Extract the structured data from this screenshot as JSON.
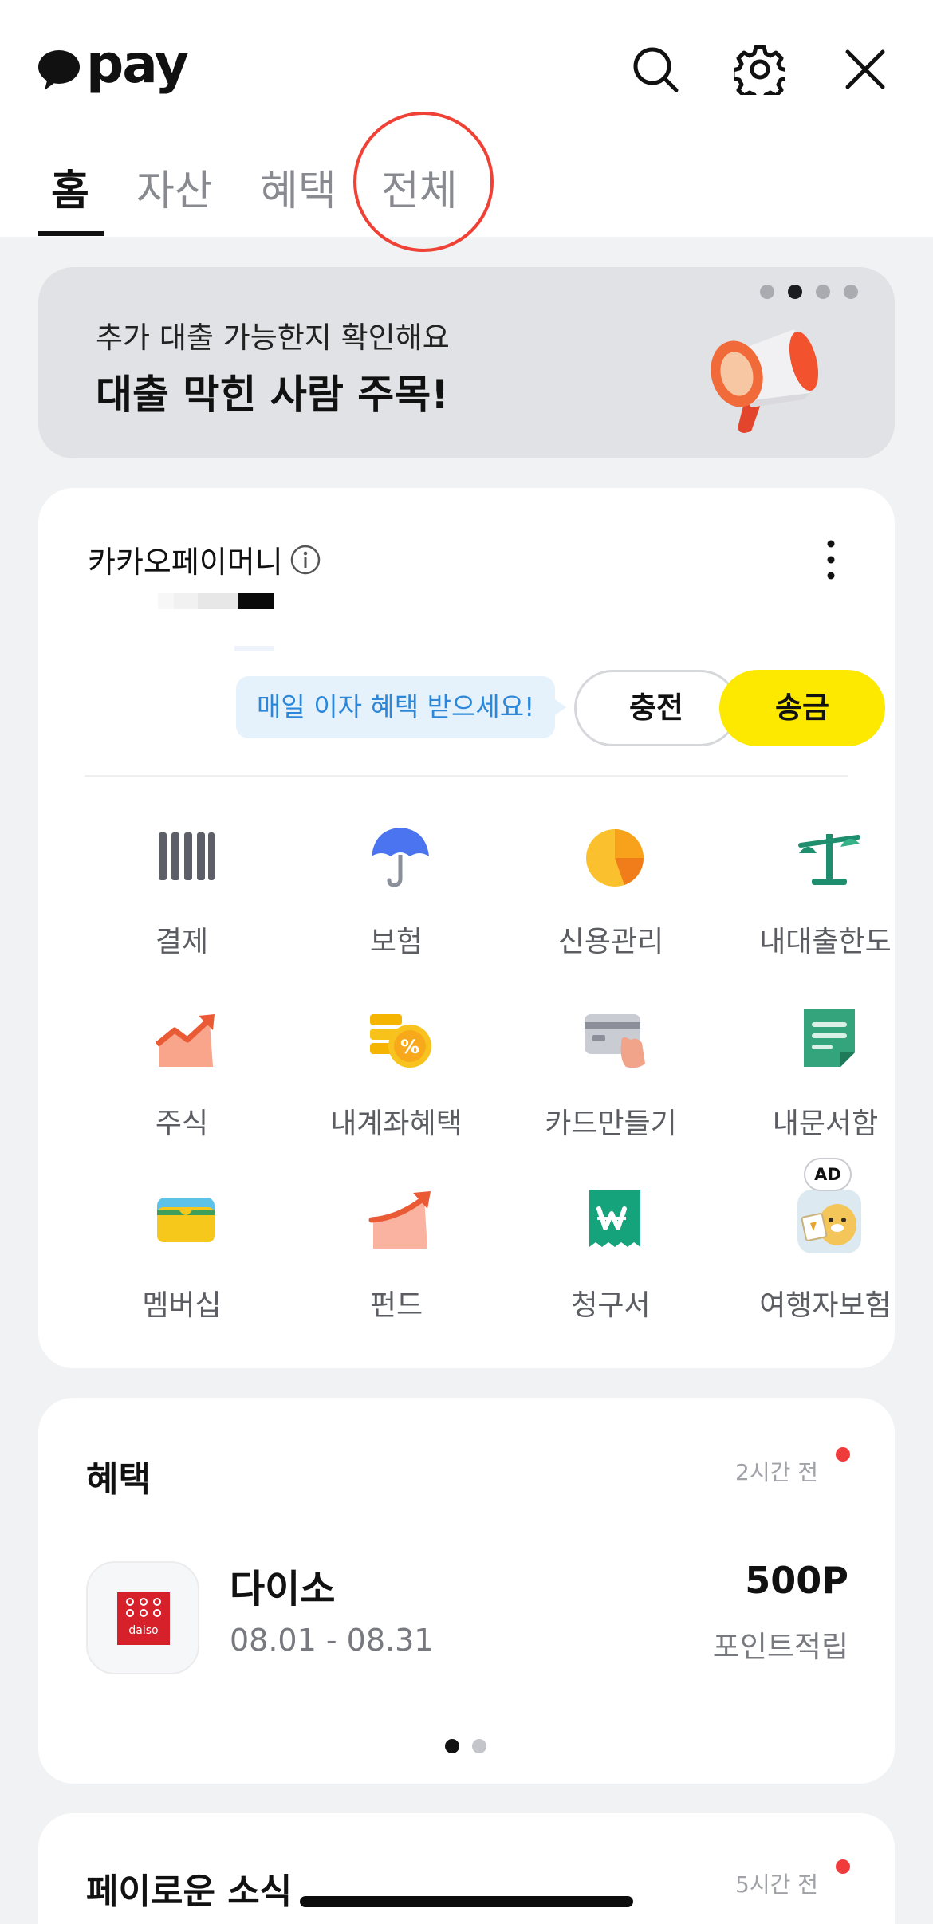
{
  "app": {
    "logo_text": "pay"
  },
  "header": {
    "icons": [
      "search-icon",
      "gear-icon",
      "close-icon"
    ],
    "tabs": [
      {
        "label": "홈",
        "active": true
      },
      {
        "label": "자산",
        "active": false
      },
      {
        "label": "혜택",
        "active": false
      },
      {
        "label": "전체",
        "active": false,
        "highlighted": true
      }
    ]
  },
  "banner": {
    "subtitle": "추가 대출 가능한지 확인해요",
    "title": "대출 막힌 사람 주목!",
    "page_count": 4,
    "active_page": 2,
    "icon": "megaphone-icon"
  },
  "money": {
    "label": "카카오페이머니",
    "tooltip": "매일 이자 혜택 받으세요!",
    "charge_label": "충전",
    "send_label": "송금",
    "services": [
      {
        "label": "결제",
        "icon": "barcode-icon"
      },
      {
        "label": "보험",
        "icon": "umbrella-icon"
      },
      {
        "label": "신용관리",
        "icon": "credit-gauge-icon"
      },
      {
        "label": "내대출한도",
        "icon": "scale-icon"
      },
      {
        "label": "주식",
        "icon": "stock-chart-icon"
      },
      {
        "label": "내계좌혜택",
        "icon": "coins-percent-icon"
      },
      {
        "label": "카드만들기",
        "icon": "card-hand-icon"
      },
      {
        "label": "내문서함",
        "icon": "document-icon"
      },
      {
        "label": "멤버십",
        "icon": "wallet-icon"
      },
      {
        "label": "펀드",
        "icon": "fund-growth-icon"
      },
      {
        "label": "청구서",
        "icon": "bill-won-icon"
      },
      {
        "label": "여행자보험",
        "icon": "traveler-character-icon",
        "badge": "AD"
      }
    ]
  },
  "benefit": {
    "title": "혜택",
    "time": "2시간 전",
    "item": {
      "name": "다이소",
      "logo_text": "daiso",
      "date": "08.01 - 08.31",
      "value": "500P",
      "desc": "포인트적립"
    },
    "page_count": 2,
    "active_page": 1
  },
  "news": {
    "title": "페이로운 소식",
    "time": "5시간 전"
  },
  "colors": {
    "accent_yellow": "#fde800",
    "highlight_red": "#ef4135",
    "tooltip_blue": "#2c87d8",
    "background": "#f1f2f4"
  }
}
